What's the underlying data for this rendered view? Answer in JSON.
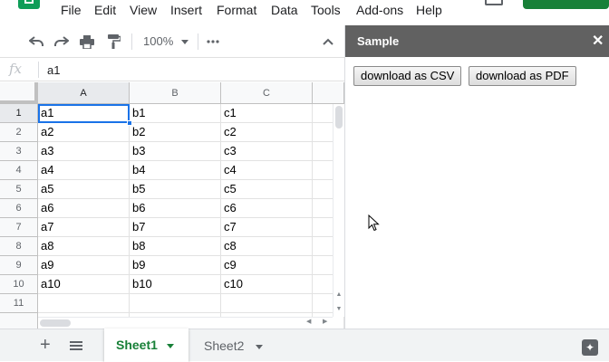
{
  "menu": [
    "File",
    "Edit",
    "View",
    "Insert",
    "Format",
    "Data",
    "Tools",
    "Add-ons",
    "Help"
  ],
  "toolbar": {
    "zoom": "100%",
    "icons": [
      "undo-icon",
      "redo-icon",
      "print-icon",
      "paint-format-icon",
      "more-icon",
      "collapse-icon"
    ]
  },
  "formula_bar": {
    "fx": "fx",
    "content": "a1"
  },
  "grid": {
    "columns": [
      "A",
      "B",
      "C",
      ""
    ],
    "rows": [
      "1",
      "2",
      "3",
      "4",
      "5",
      "6",
      "7",
      "8",
      "9",
      "10",
      "11",
      ""
    ],
    "cells": [
      [
        "a1",
        "b1",
        "c1"
      ],
      [
        "a2",
        "b2",
        "c2"
      ],
      [
        "a3",
        "b3",
        "c3"
      ],
      [
        "a4",
        "b4",
        "c4"
      ],
      [
        "a5",
        "b5",
        "c5"
      ],
      [
        "a6",
        "b6",
        "c6"
      ],
      [
        "a7",
        "b7",
        "c7"
      ],
      [
        "a8",
        "b8",
        "c8"
      ],
      [
        "a9",
        "b9",
        "c9"
      ],
      [
        "a10",
        "b10",
        "c10"
      ],
      [
        "",
        "",
        ""
      ],
      [
        "",
        "",
        ""
      ]
    ],
    "active_cell": "A1"
  },
  "sidebar": {
    "title": "Sample",
    "close": "✕",
    "buttons": [
      "download as CSV",
      "download as PDF"
    ]
  },
  "tabs": {
    "add": "+",
    "sheets": [
      "Sheet1",
      "Sheet2"
    ],
    "active": "Sheet1"
  },
  "colors": {
    "accent_green": "#188038",
    "selection_blue": "#1a73e8",
    "sidebar_header": "#616161"
  }
}
